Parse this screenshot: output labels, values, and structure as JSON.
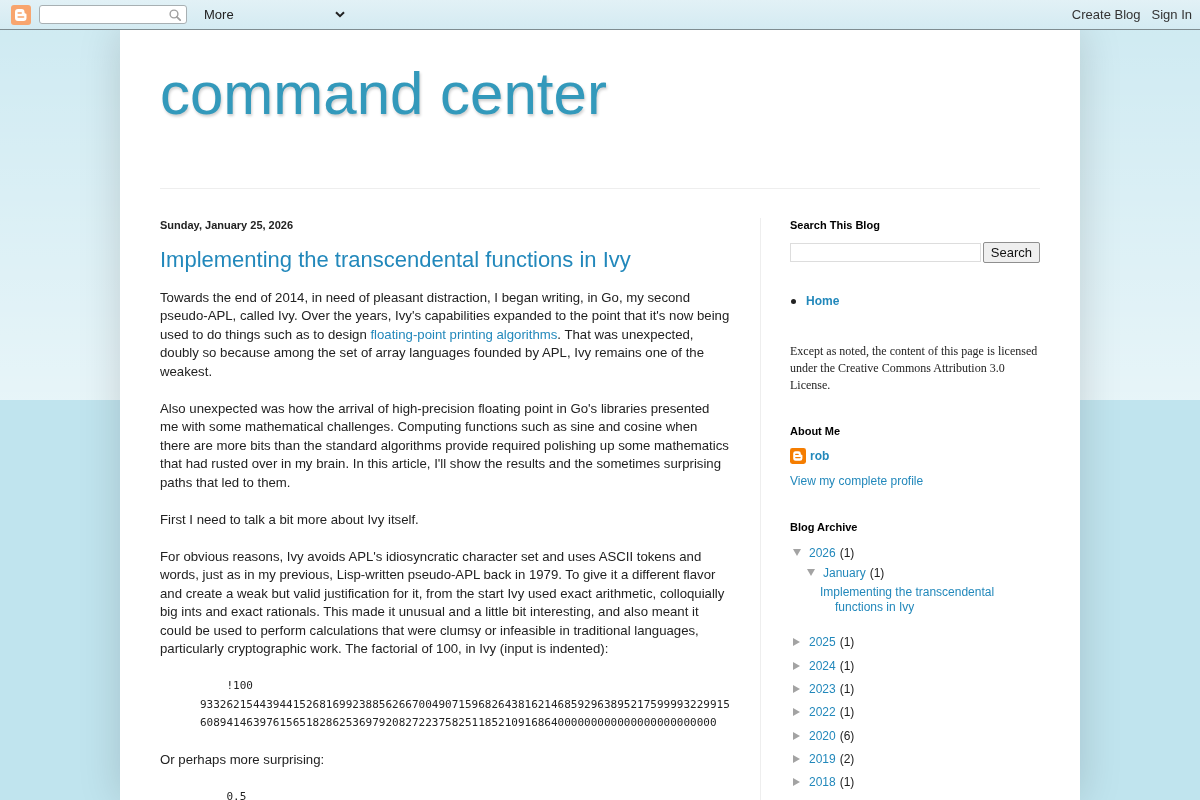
{
  "navbar": {
    "menu": "More",
    "links": [
      "Create Blog",
      "Sign In"
    ]
  },
  "header": {
    "title": "command center"
  },
  "post": {
    "date": "Sunday, January 25, 2026",
    "title": "Implementing the transcendental functions in Ivy",
    "body": [
      {
        "kind": "paragraph",
        "parts": [
          {
            "kind": "text",
            "text": "Towards the end of 2014, in need of pleasant distraction, I began writing, in Go, my second pseudo-APL, called Ivy. Over the years, Ivy's capabilities expanded to the point that it's now being used to do things such as to design "
          },
          {
            "kind": "link",
            "text": "floating-point printing algorithms"
          },
          {
            "kind": "text",
            "text": ". That was unexpected, doubly so because among the set of array languages founded by APL, Ivy remains one of the weakest."
          }
        ]
      },
      {
        "kind": "paragraph",
        "parts": [
          {
            "kind": "text",
            "text": "Also unexpected was how the arrival of high-precision floating point in Go's libraries presented me with some mathematical challenges. Computing functions such as sine and cosine when there are more bits than the standard algorithms provide required polishing up some mathematics that had rusted over in my brain. In this article, I'll show the results and the sometimes surprising paths that led to them."
          }
        ]
      },
      {
        "kind": "paragraph",
        "parts": [
          {
            "kind": "text",
            "text": "First I need to talk a bit more about Ivy itself."
          }
        ]
      },
      {
        "kind": "paragraph",
        "parts": [
          {
            "kind": "text",
            "text": "For obvious reasons, Ivy avoids APL's idiosyncratic character set and uses ASCII tokens and words, just as in my previous, Lisp-written pseudo-APL back in 1979. To give it a different flavor and create a weak but valid justification for it, from the start Ivy used exact arithmetic, colloquially big ints and exact rationals. This made it unusual and a little bit interesting, and also meant it could be used to perform calculations that were clumsy or infeasible in traditional languages, particularly cryptographic work. The factorial of 100, in Ivy (input is indented):"
          }
        ]
      },
      {
        "kind": "code",
        "lines": [
          "    !100",
          "93326215443944152681699238856266700490715968264381621468592963895217599993229915",
          "608941463976156518286253697920827223758251185210916864000000000000000000000000"
        ]
      },
      {
        "kind": "paragraph",
        "parts": [
          {
            "kind": "text",
            "text": "Or perhaps more surprising:"
          }
        ]
      },
      {
        "kind": "code",
        "lines": [
          "    0.5"
        ]
      }
    ]
  },
  "sidebar": [
    {
      "kind": "search",
      "title": "Search This Blog",
      "button": "Search"
    },
    {
      "kind": "pages",
      "items": [
        {
          "label": "Home",
          "selected": true
        }
      ]
    },
    {
      "kind": "text",
      "text": "Except as noted, the content of this page is licensed under the Creative Commons Attribution 3.0 License."
    },
    {
      "kind": "profile",
      "title": "About Me",
      "name": "rob",
      "link": "View my complete profile"
    },
    {
      "kind": "archive",
      "title": "Blog Archive",
      "items": [
        {
          "label": "2026",
          "count": "(1)",
          "expanded": true,
          "children": [
            {
              "label": "January",
              "count": "(1)",
              "expanded": true,
              "children": [
                {
                  "label": "Implementing the transcendental functions in Ivy"
                }
              ]
            }
          ]
        },
        {
          "label": "2025",
          "count": "(1)",
          "expanded": false
        },
        {
          "label": "2024",
          "count": "(1)",
          "expanded": false
        },
        {
          "label": "2023",
          "count": "(1)",
          "expanded": false
        },
        {
          "label": "2022",
          "count": "(1)",
          "expanded": false
        },
        {
          "label": "2020",
          "count": "(6)",
          "expanded": false
        },
        {
          "label": "2019",
          "count": "(2)",
          "expanded": false
        },
        {
          "label": "2018",
          "count": "(1)",
          "expanded": false
        }
      ]
    }
  ]
}
